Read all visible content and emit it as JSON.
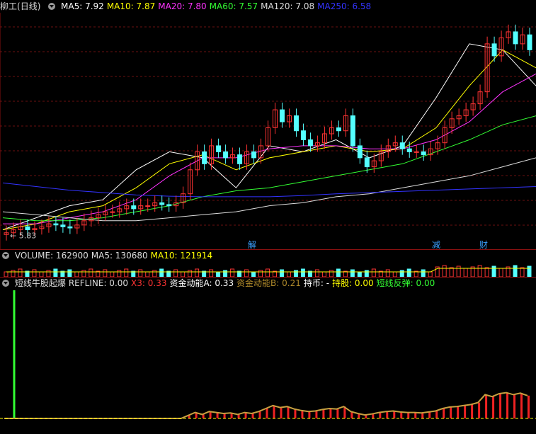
{
  "main_panel": {
    "stock_name": "柳工",
    "period": "(日线)",
    "ma_items": [
      {
        "label": "MA5: 7.92",
        "color": "#ffffff"
      },
      {
        "label": "MA10: 7.87",
        "color": "#ffff00"
      },
      {
        "label": "MA20: 7.80",
        "color": "#ff33ff"
      },
      {
        "label": "MA60: 7.57",
        "color": "#33ff33"
      },
      {
        "label": "MA120: 7.08",
        "color": "#dddddd"
      },
      {
        "label": "MA250: 6.58",
        "color": "#3333ff"
      }
    ],
    "low_label": "5.83",
    "event_markers": [
      {
        "text": "解",
        "idx": 74
      },
      {
        "text": "减",
        "idx": 129
      },
      {
        "text": "财",
        "idx": 143
      }
    ]
  },
  "volume_panel": {
    "items": [
      {
        "label": "VOLUME: 162900",
        "color": "#dddddd"
      },
      {
        "label": "MA5: 130680",
        "color": "#dddddd"
      },
      {
        "label": "MA10: 121914",
        "color": "#ffff00"
      }
    ]
  },
  "indicator_panel": {
    "items": [
      {
        "label": "短线牛股起爆",
        "color": "#dddddd"
      },
      {
        "label": "REFLINE: 0.00",
        "color": "#dddddd"
      },
      {
        "label": "X3: 0.33",
        "color": "#ff3333"
      },
      {
        "label": "资金动能A: 0.33",
        "color": "#ffffff"
      },
      {
        "label": "资金动能B: 0.21",
        "color": "#b08a2a"
      },
      {
        "label": "持币: -",
        "color": "#ffffff"
      },
      {
        "label": "持股: 0.00",
        "color": "#ffff00"
      },
      {
        "label": "短线反弹: 0.00",
        "color": "#33ff33"
      }
    ]
  },
  "chart_data": {
    "type": "candlestick",
    "price_range": [
      5.8,
      9.4
    ],
    "ma_lines": [
      {
        "name": "MA5",
        "color": "#ffffff",
        "values": [
          5.9,
          6.1,
          6.3,
          6.4,
          6.9,
          7.2,
          7.1,
          6.6,
          7.3,
          7.2,
          7.4,
          7.1,
          7.3,
          8.1,
          9.0,
          8.9,
          8.3
        ]
      },
      {
        "name": "MA10",
        "color": "#ffff00",
        "values": [
          5.9,
          6.0,
          6.2,
          6.3,
          6.6,
          7.0,
          7.15,
          6.9,
          7.1,
          7.2,
          7.3,
          7.2,
          7.25,
          7.6,
          8.3,
          8.9,
          8.6
        ]
      },
      {
        "name": "MA20",
        "color": "#ff33ff",
        "values": [
          6.0,
          6.0,
          6.1,
          6.2,
          6.4,
          6.8,
          7.1,
          7.1,
          7.25,
          7.3,
          7.3,
          7.25,
          7.25,
          7.4,
          7.7,
          8.2,
          8.5
        ]
      },
      {
        "name": "MA60",
        "color": "#33ff33",
        "values": [
          6.1,
          6.05,
          6.05,
          6.1,
          6.2,
          6.3,
          6.45,
          6.55,
          6.6,
          6.7,
          6.8,
          6.9,
          7.0,
          7.2,
          7.4,
          7.65,
          7.8
        ]
      },
      {
        "name": "MA120",
        "color": "#dddddd",
        "values": [
          6.2,
          6.15,
          6.1,
          6.05,
          6.05,
          6.1,
          6.15,
          6.2,
          6.3,
          6.35,
          6.45,
          6.5,
          6.6,
          6.7,
          6.8,
          6.95,
          7.1
        ]
      },
      {
        "name": "MA250",
        "color": "#3333ff",
        "values": [
          6.68,
          6.62,
          6.56,
          6.52,
          6.48,
          6.46,
          6.45,
          6.45,
          6.45,
          6.47,
          6.5,
          6.52,
          6.54,
          6.56,
          6.58,
          6.6,
          6.62
        ]
      }
    ],
    "candle_closes": [
      5.85,
      5.9,
      5.95,
      5.9,
      5.92,
      5.95,
      6.0,
      5.98,
      5.95,
      5.93,
      5.98,
      6.05,
      6.1,
      6.15,
      6.2,
      6.2,
      6.25,
      6.3,
      6.25,
      6.3,
      6.3,
      6.35,
      6.32,
      6.3,
      6.35,
      6.5,
      6.9,
      7.2,
      7.0,
      7.3,
      7.2,
      7.1,
      7.15,
      7.0,
      7.2,
      7.1,
      7.3,
      7.6,
      7.9,
      7.7,
      7.8,
      7.55,
      7.4,
      7.3,
      7.35,
      7.5,
      7.6,
      7.55,
      7.8,
      7.3,
      7.1,
      6.95,
      7.05,
      7.2,
      7.3,
      7.35,
      7.25,
      7.2,
      7.2,
      7.15,
      7.25,
      7.35,
      7.6,
      7.75,
      7.8,
      7.9,
      8.0,
      8.2,
      9.0,
      8.8,
      9.1,
      9.2,
      9.0,
      9.15,
      8.9
    ]
  }
}
